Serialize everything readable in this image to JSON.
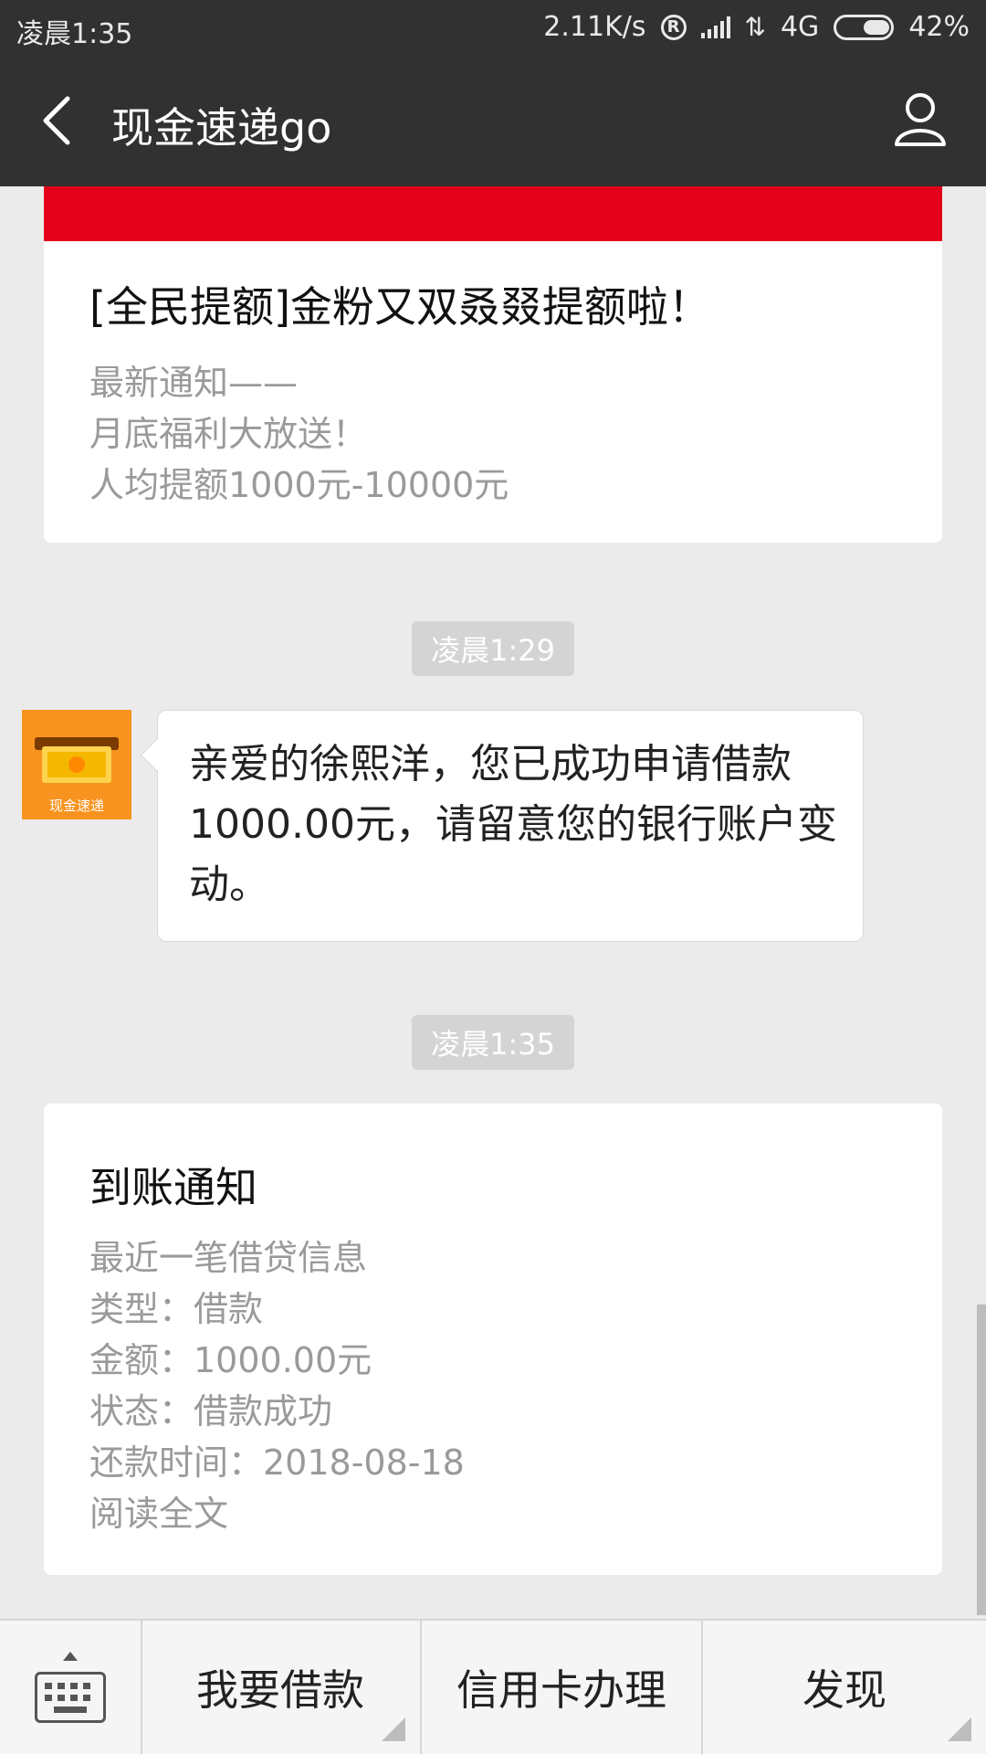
{
  "status_bar": {
    "time": "凌晨1:35",
    "net_speed": "2.11K/s",
    "network": "4G",
    "battery": "42%"
  },
  "header": {
    "title": "现金速递go",
    "back_icon": "back-arrow-icon",
    "profile_icon": "user-icon"
  },
  "messages": {
    "card1": {
      "title": "[全民提额]金粉又双叒叕提额啦！",
      "lines": [
        "最新通知——",
        "月底福利大放送！",
        "人均提额1000元-10000元"
      ]
    },
    "time1": "凌晨1:29",
    "chat": {
      "avatar_label": "现金速递",
      "text": "亲爱的徐熙洋，您已成功申请借款1000.00元，请留意您的银行账户变动。"
    },
    "time2": "凌晨1:35",
    "card2": {
      "title": "到账通知",
      "lines": [
        "最近一笔借贷信息",
        "类型：借款",
        "金额：1000.00元",
        "状态：借款成功",
        "还款时间：2018-08-18",
        "阅读全文"
      ]
    }
  },
  "menu": {
    "keyboard_icon": "keyboard-icon",
    "items": [
      "我要借款",
      "信用卡办理",
      "发现"
    ]
  },
  "colors": {
    "header_bg": "#313131",
    "banner_red": "#e2001a",
    "avatar_orange": "#f7931e"
  }
}
